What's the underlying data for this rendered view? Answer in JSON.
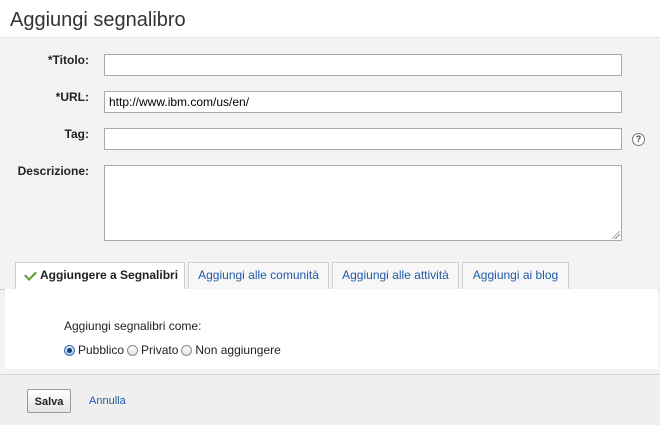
{
  "header": {
    "title": "Aggiungi segnalibro"
  },
  "form": {
    "title_label": "*Titolo:",
    "title_value": "",
    "url_label": "*URL:",
    "url_value": "http://www.ibm.com/us/en/",
    "tag_label": "Tag:",
    "tag_value": "",
    "help_glyph": "?",
    "description_label": "Descrizione:",
    "description_value": ""
  },
  "tabs": [
    {
      "label": "Aggiungere a Segnalibri",
      "active": true
    },
    {
      "label": "Aggiungi alle comunità",
      "active": false
    },
    {
      "label": "Aggiungi alle attività",
      "active": false
    },
    {
      "label": "Aggiungi ai blog",
      "active": false
    }
  ],
  "panel": {
    "as_label": "Aggiungi segnalibri come:",
    "options": [
      {
        "label": "Pubblico",
        "selected": true
      },
      {
        "label": "Privato",
        "selected": false
      },
      {
        "label": "Non aggiungere",
        "selected": false
      }
    ]
  },
  "footer": {
    "save_label": "Salva",
    "cancel_label": "Annulla"
  },
  "colors": {
    "link": "#1f5aa6",
    "check": "#5aa02c",
    "background": "#f3f3f3"
  }
}
